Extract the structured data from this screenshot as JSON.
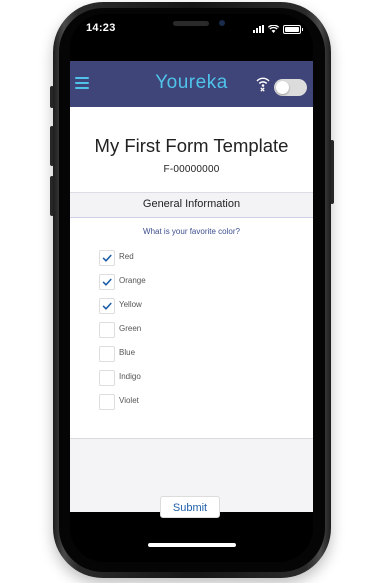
{
  "status_bar": {
    "time": "14:23"
  },
  "header": {
    "brand": "Youreka",
    "menu_icon": "hamburger-menu-icon",
    "offline_icon": "wifi-offline-icon",
    "toggle_on": false,
    "colors": {
      "header_bg": "#3f4479",
      "brand": "#4fc3ea"
    }
  },
  "form": {
    "title": "My First Form Template",
    "id": "F-00000000",
    "section": "General Information",
    "question": "What is your favorite color?",
    "options": [
      {
        "label": "Red",
        "checked": true
      },
      {
        "label": "Orange",
        "checked": true
      },
      {
        "label": "Yellow",
        "checked": true
      },
      {
        "label": "Green",
        "checked": false
      },
      {
        "label": "Blue",
        "checked": false
      },
      {
        "label": "Indigo",
        "checked": false
      },
      {
        "label": "Violet",
        "checked": false
      }
    ],
    "submit_label": "Submit",
    "colors": {
      "question": "#3e4f8f",
      "check": "#1f5faa",
      "submit": "#1f5faa"
    }
  }
}
